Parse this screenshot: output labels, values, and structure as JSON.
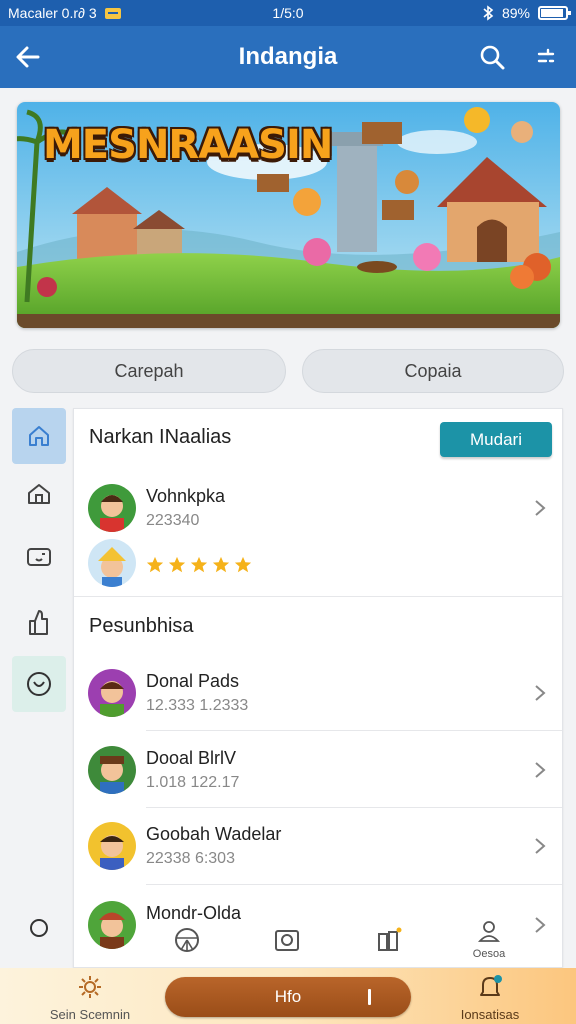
{
  "status_bar": {
    "carrier": "Macaler 0.r∂ 3",
    "time": "1/5:0",
    "battery": "89%"
  },
  "app_bar": {
    "title": "Indangia",
    "back_icon": "arrow-left-icon",
    "search_icon": "search-icon",
    "menu_icon": "more-icon"
  },
  "banner": {
    "title": "MESNRAASIN"
  },
  "pills": {
    "left": "Carepah",
    "right": "Copaia"
  },
  "side_nav": {
    "icons": [
      "home-icon",
      "home-outline-icon",
      "chat-box-icon",
      "thumbs-icon",
      "circle-smile-icon"
    ],
    "bottom_icon": "circle-icon"
  },
  "section1": {
    "title": "Narkan INaalias",
    "button": "Mudari",
    "item": {
      "name": "Vohnkpka",
      "sub": "223340"
    },
    "rating": 5
  },
  "section2": {
    "title": "Pesunbhisa",
    "items": [
      {
        "name": "Donal Pads",
        "sub": "12.333 1.2333"
      },
      {
        "name": "Dooal BlrlV",
        "sub": "1.018 122.17"
      },
      {
        "name": "Goobah Wadelar",
        "sub": "22338 6:303"
      },
      {
        "name": "Mondr-Olda",
        "sub": ""
      }
    ]
  },
  "mid_row": {
    "icons": [
      "steering-icon",
      "photo-icon",
      "battery-plus-icon",
      "person-icon"
    ],
    "person_label": "Oesoa"
  },
  "bottom_bar": {
    "left_label": "Sein Scemnin",
    "center_label": "Hfo",
    "right_label": "Ionsatisas",
    "colors": {
      "pill": "#a55821",
      "accent": "#f8a84a"
    }
  },
  "colors": {
    "primary": "#2a6fbd",
    "teal_button": "#1c93a7",
    "star": "#f5b21a"
  }
}
